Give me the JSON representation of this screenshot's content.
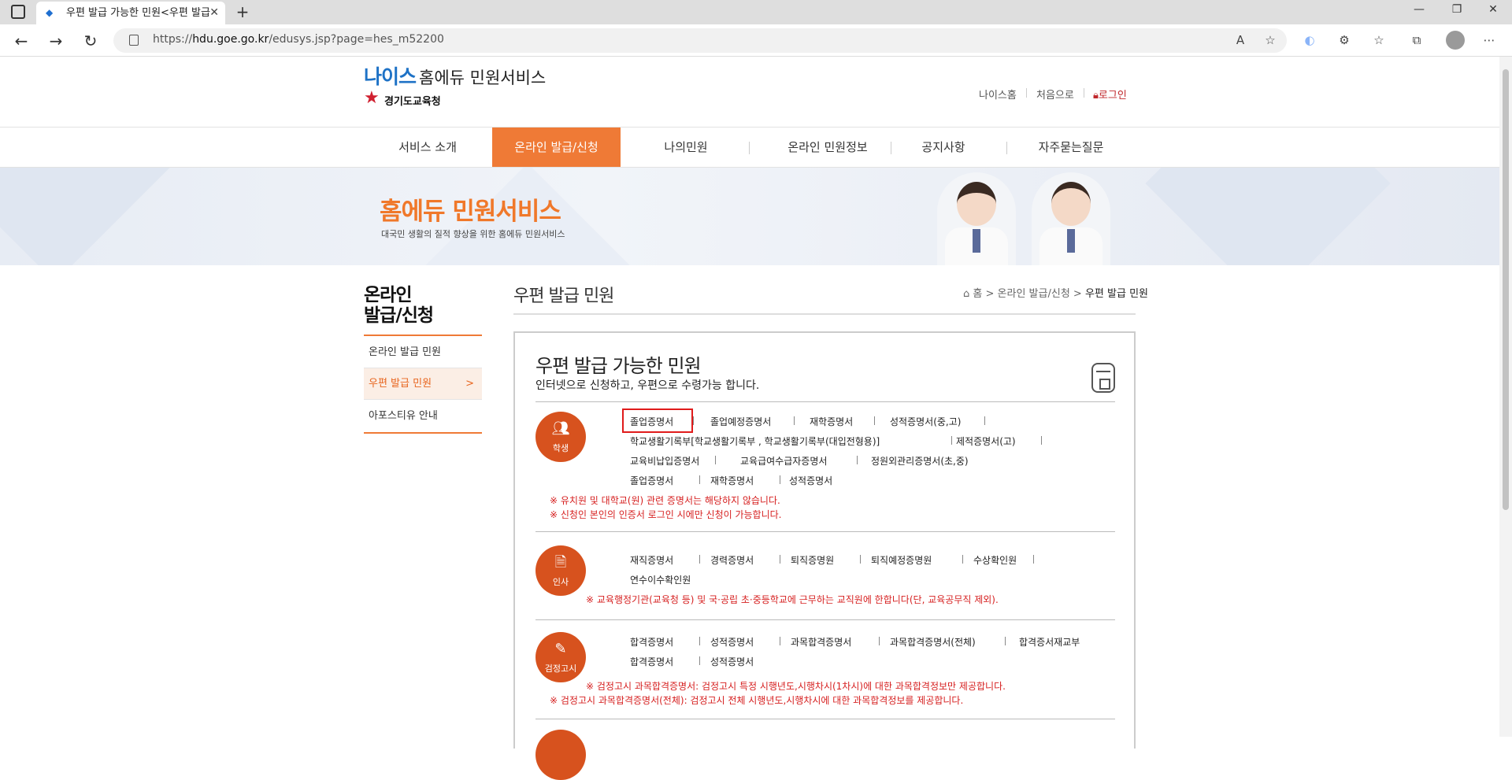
{
  "browser": {
    "tab_title": "우편 발급 가능한 민원<우편 발급",
    "url_prefix": "https://",
    "url_host": "hdu.goe.go.kr",
    "url_path": "/edusys.jsp?page=hes_m52200",
    "new_tab": "+",
    "close_tab": "✕",
    "back": "←",
    "forward": "→",
    "refresh": "↻",
    "minimize": "—",
    "restore": "❐",
    "close": "✕",
    "read_aloud": "A",
    "fav_add": "☆",
    "extensions": "⚙",
    "favorites": "☆",
    "collections": "⧉",
    "more": "⋯"
  },
  "header": {
    "logo_neis": "나이스",
    "logo_rest": "홈에듀 민원서비스",
    "logo_sub": "경기도교육청",
    "util": {
      "neis_home": "나이스홈",
      "first": "처음으로",
      "login": "로그인"
    }
  },
  "gnb": [
    "서비스 소개",
    "온라인 발급/신청",
    "나의민원",
    "온라인 민원정보",
    "공지사항",
    "자주묻는질문"
  ],
  "banner": {
    "title": "홈에듀 민원서비스",
    "subtitle": "대국민 생활의 질적 향상을 위한 홈에듀 민원서비스"
  },
  "lnb": {
    "title1": "온라인",
    "title2": "발급/신청",
    "items": [
      "온라인 발급 민원",
      "우편 발급 민원",
      "아포스티유 안내"
    ],
    "arrow": ">"
  },
  "content": {
    "page_title": "우편 발급 민원",
    "breadcrumb": {
      "home": "홈",
      "sep": ">",
      "level1": "온라인 발급/신청",
      "current": "우편 발급 민원"
    },
    "panel_title": "우편 발급 가능한 민원",
    "panel_subtitle": "인터넷으로 신청하고, 우편으로 수령가능 합니다."
  },
  "sections": {
    "student": {
      "label": "학생",
      "row1": [
        "졸업증명서",
        "졸업예정증명서",
        "재학증명서",
        "성적증명서(중,고)"
      ],
      "row2": [
        "학교생활기록부[학교생활기록부 , 학교생활기록부(대입전형용)]",
        "제적증명서(고)"
      ],
      "row3": [
        "교육비납입증명서",
        "교육급여수급자증명서",
        "정원외관리증명서(초,중)"
      ],
      "row4": [
        "졸업증명서",
        "재학증명서",
        "성적증명서"
      ],
      "notes": [
        "※ 유치원 및 대학교(원) 관련 증명서는 해당하지 않습니다.",
        "※ 신청인 본인의 인증서 로그인 시에만 신청이 가능합니다."
      ]
    },
    "personnel": {
      "label": "인사",
      "row1": [
        "재직증명서",
        "경력증명서",
        "퇴직증명원",
        "퇴직예정증명원",
        "수상확인원"
      ],
      "row2": [
        "연수이수확인원"
      ],
      "notes": [
        "※ 교육행정기관(교육청 등) 및 국·공립 초·중등학교에 근무하는 교직원에 한합니다(단, 교육공무직 제외)."
      ]
    },
    "exam": {
      "label": "검정고시",
      "row1": [
        "합격증명서",
        "성적증명서",
        "과목합격증명서",
        "과목합격증명서(전체)",
        "합격증서재교부"
      ],
      "row2": [
        "합격증명서",
        "성적증명서"
      ],
      "notes": [
        "※ 검정고시 과목합격증명서: 검정고시 특정 시행년도,시행차시(1차시)에 대한 과목합격정보만 제공합니다.",
        "※ 검정고시 과목합격증명서(전체): 검정고시 전체 시행년도,시행차시에 대한 과목합격정보를 제공합니다."
      ]
    }
  },
  "colors": {
    "accent": "#ef7a36",
    "circle": "#d7521e",
    "note": "#d61f1f",
    "logo_blue": "#1e72c6",
    "highlight": "#e01b1b"
  }
}
